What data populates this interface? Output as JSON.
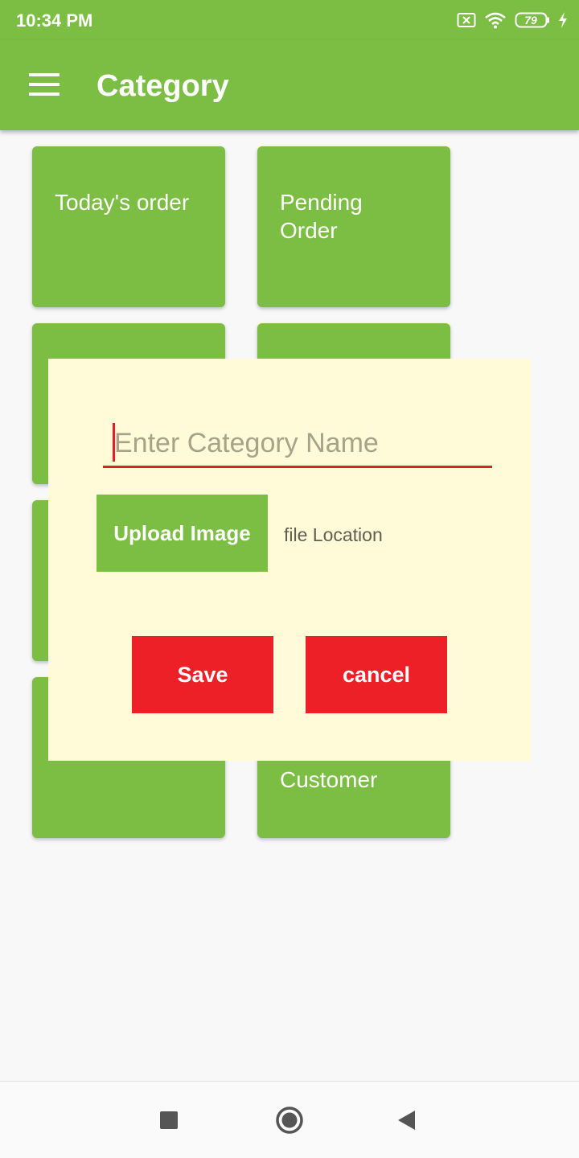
{
  "status_bar": {
    "time": "10:34 PM",
    "battery": "79",
    "icons": [
      "sim-off-icon",
      "wifi-icon",
      "battery-icon",
      "charging-icon"
    ]
  },
  "app_bar": {
    "title": "Category",
    "menu_icon": "hamburger-menu-icon"
  },
  "tiles": [
    {
      "label": "Today's order"
    },
    {
      "label": "Pending\nOrder"
    },
    {
      "label": ""
    },
    {
      "label": ""
    },
    {
      "label": ""
    },
    {
      "label": ""
    },
    {
      "label": ""
    },
    {
      "label": "Customer"
    }
  ],
  "dialog": {
    "name_input": {
      "value": "",
      "placeholder": "Enter Category Name"
    },
    "upload_label": "Upload Image",
    "file_location": "file Location",
    "save_label": "Save",
    "cancel_label": "cancel"
  },
  "nav_bar": {
    "buttons": [
      "recents-icon",
      "home-icon",
      "back-icon"
    ]
  },
  "colors": {
    "primary": "#7cbd43",
    "accent": "#ed1f27",
    "dialog_bg": "#fffad8",
    "background": "#f8f8f8"
  }
}
